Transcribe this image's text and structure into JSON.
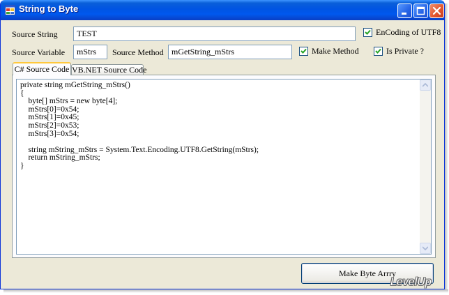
{
  "window": {
    "title": "String to Byte"
  },
  "form": {
    "source_string_label": "Source String",
    "source_string_value": "TEST",
    "utf8_label": "EnCoding of UTF8",
    "utf8_checked": true,
    "source_variable_label": "Source Variable",
    "source_variable_value": "mStrs",
    "source_method_label": "Source Method",
    "source_method_value": "mGetString_mStrs",
    "make_method_label": "Make Method",
    "make_method_checked": true,
    "is_private_label": "Is Private ?",
    "is_private_checked": true
  },
  "tabs": [
    {
      "label": "C# Source Code",
      "active": true
    },
    {
      "label": "VB.NET Source Code",
      "active": false
    }
  ],
  "code": {
    "lines": [
      "private string mGetString_mStrs()",
      "{",
      "    byte[] mStrs = new byte[4];",
      "    mStrs[0]=0x54;",
      "    mStrs[1]=0x45;",
      "    mStrs[2]=0x53;",
      "    mStrs[3]=0x54;",
      "",
      "    string mString_mStrs = System.Text.Encoding.UTF8.GetString(mStrs);",
      "    return mString_mStrs;",
      "}"
    ]
  },
  "buttons": {
    "make_byte_array": "Make Byte Arrry"
  },
  "watermark": "LevelUp",
  "colors": {
    "titlebar": "#0054e3",
    "check": "#21a121",
    "window_bg": "#ece9d8"
  }
}
